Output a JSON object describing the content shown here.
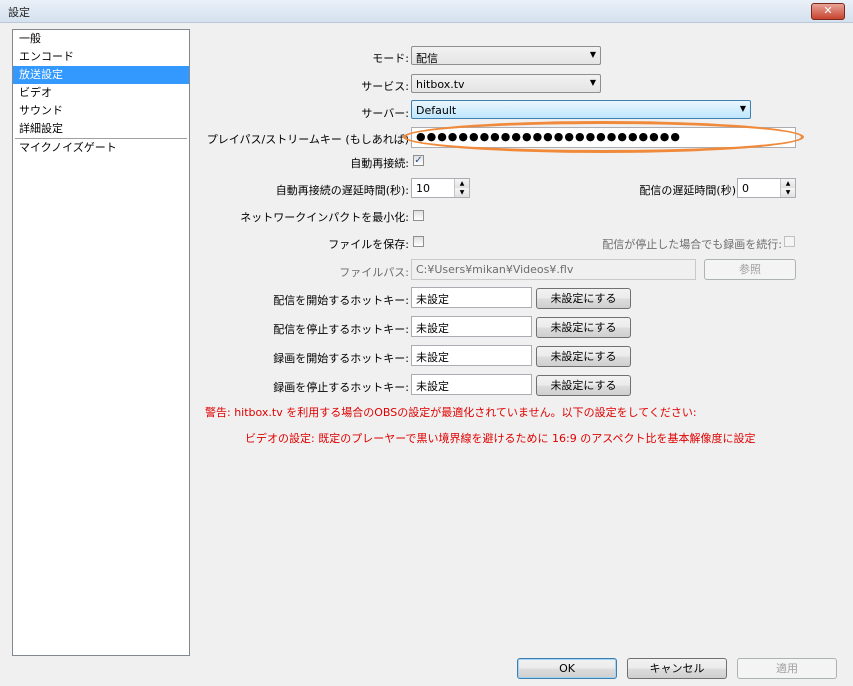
{
  "window": {
    "title": "設定",
    "close_label": "✕"
  },
  "sidebar": {
    "items": [
      {
        "label": "一般"
      },
      {
        "label": "エンコード"
      },
      {
        "label": "放送設定"
      },
      {
        "label": "ビデオ"
      },
      {
        "label": "サウンド"
      },
      {
        "label": "詳細設定"
      },
      {
        "label": "マイクノイズゲート"
      }
    ],
    "selected": "放送設定"
  },
  "form": {
    "mode": {
      "label": "モード:",
      "value": "配信"
    },
    "service": {
      "label": "サービス:",
      "value": "hitbox.tv"
    },
    "server": {
      "label": "サーバー:",
      "value": "Default"
    },
    "stream_key": {
      "label": "プレイパス/ストリームキー (もしあれば)",
      "value": "●●●●●●●●●●●●●●●●●●●●●●●●●"
    },
    "auto_reconnect": {
      "label": "自動再接続:",
      "checked": "✓"
    },
    "reconnect_delay": {
      "label": "自動再接続の遅延時間(秒):",
      "value": "10"
    },
    "stream_delay": {
      "label": "配信の遅延時間(秒)",
      "value": "0"
    },
    "minimize_network": {
      "label": "ネットワークインパクトを最小化:"
    },
    "save_file": {
      "label": "ファイルを保存:"
    },
    "keep_recording": {
      "label": "配信が停止した場合でも録画を続行:"
    },
    "file_path": {
      "label": "ファイルパス:",
      "value": "C:¥Users¥mikan¥Videos¥.flv",
      "browse_label": "参照"
    },
    "hotkeys": [
      {
        "label": "配信を開始するホットキー:",
        "value": "未設定",
        "clear_label": "未設定にする"
      },
      {
        "label": "配信を停止するホットキー:",
        "value": "未設定",
        "clear_label": "未設定にする"
      },
      {
        "label": "録画を開始するホットキー:",
        "value": "未設定",
        "clear_label": "未設定にする"
      },
      {
        "label": "録画を停止するホットキー:",
        "value": "未設定",
        "clear_label": "未設定にする"
      }
    ],
    "warning_1": "警告: hitbox.tv を利用する場合のOBSの設定が最適化されていません。以下の設定をしてください:",
    "warning_2": "ビデオの設定: 既定のプレーヤーで黒い境界線を避けるために 16:9 のアスペクト比を基本解像度に設定"
  },
  "footer": {
    "ok_label": "OK",
    "cancel_label": "キャンセル",
    "apply_label": "適用"
  },
  "colors": {
    "selection": "#3399ff",
    "warning": "#e00000",
    "highlight_ellipse": "#f08a3a"
  }
}
